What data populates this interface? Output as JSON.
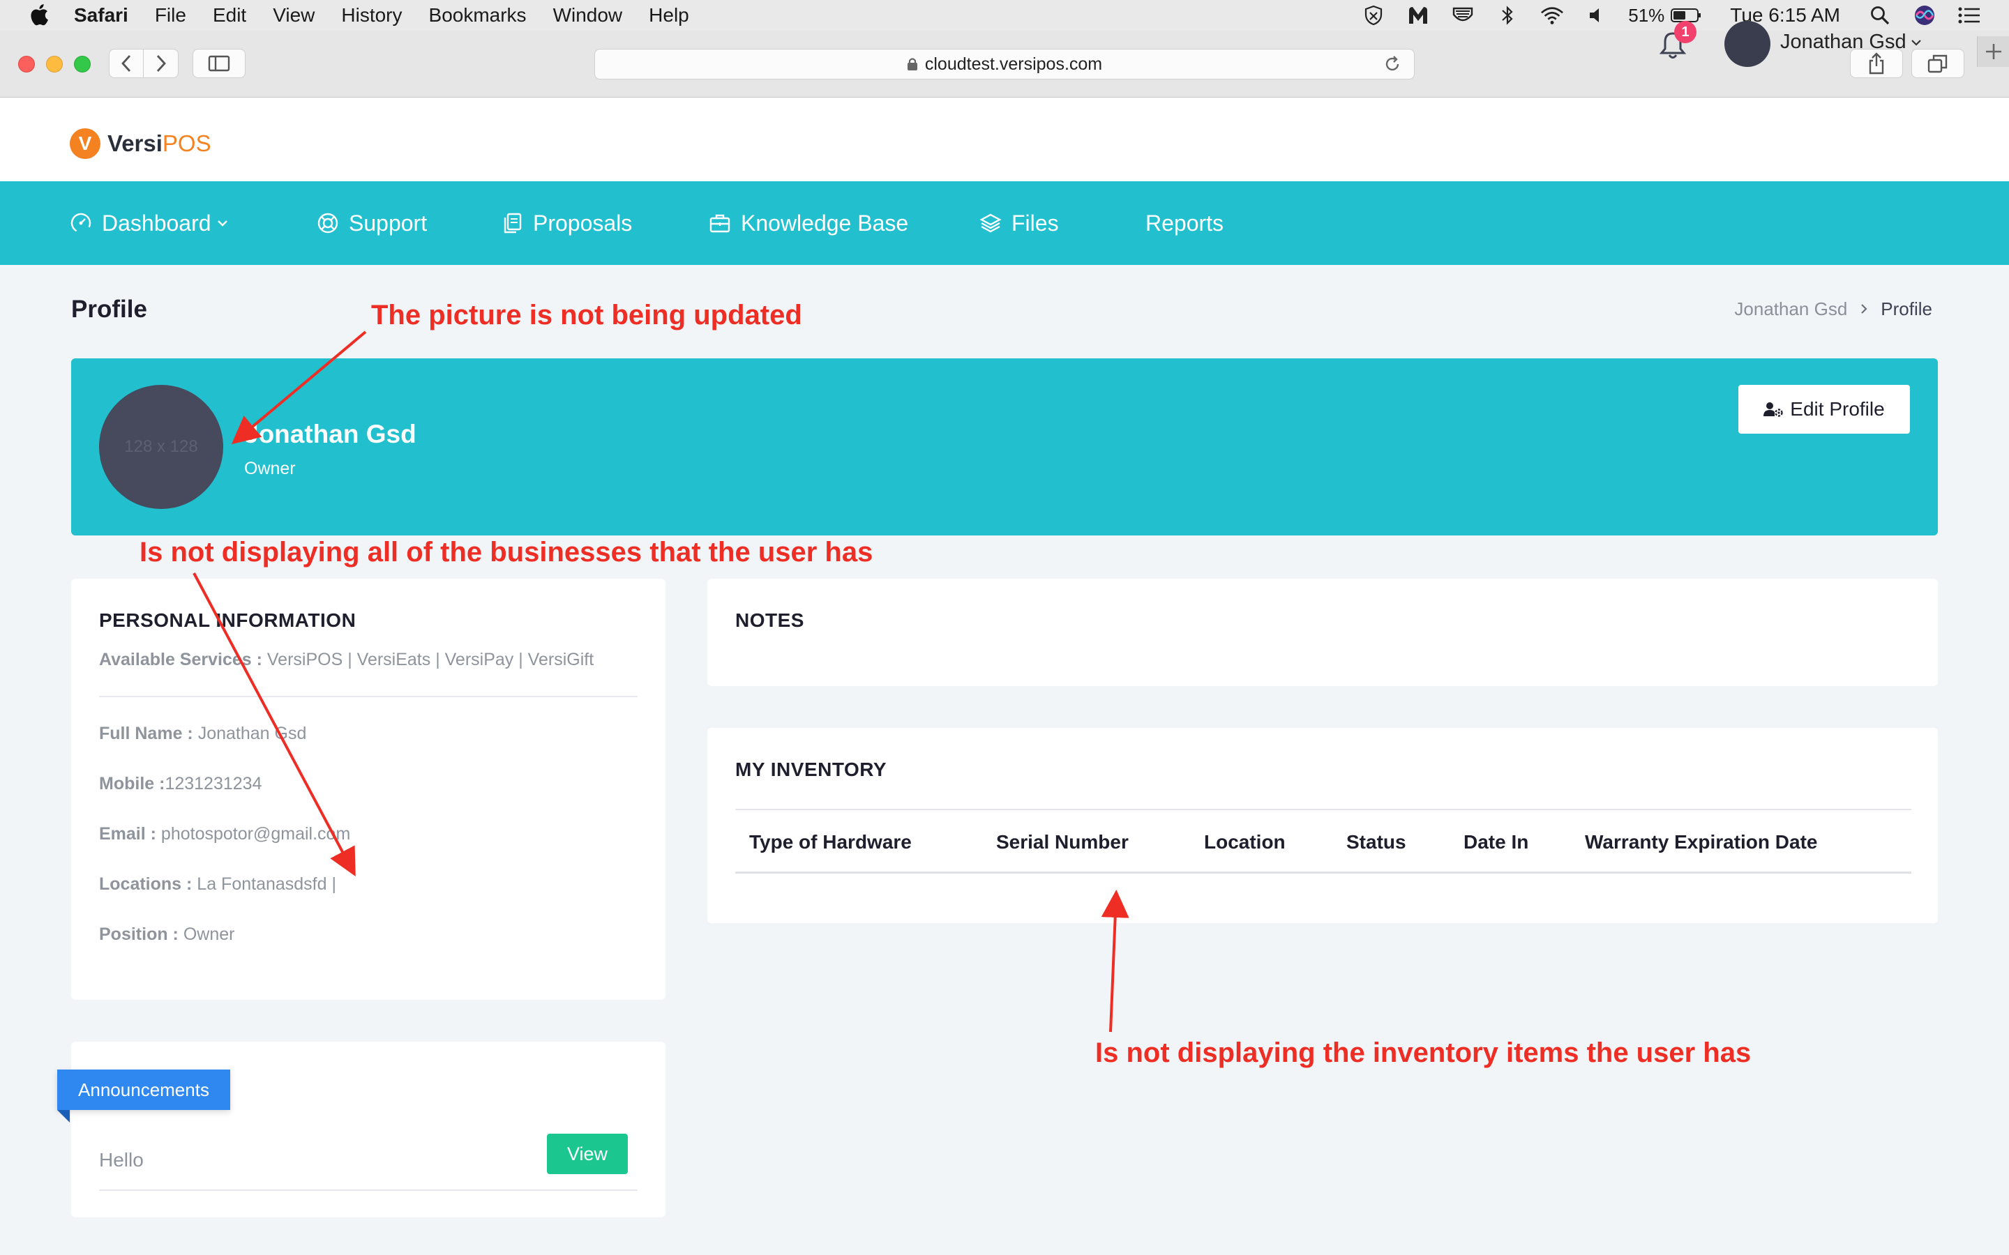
{
  "menubar": {
    "app": "Safari",
    "items": [
      "File",
      "Edit",
      "View",
      "History",
      "Bookmarks",
      "Window",
      "Help"
    ],
    "battery": "51%",
    "clock": "Tue 6:15 AM",
    "icons": [
      "shield-icon",
      "malwarebytes-icon",
      "drive-icon",
      "bluetooth-icon",
      "wifi-icon",
      "volume-icon",
      "battery-icon",
      "search-icon",
      "siri-icon",
      "list-icon"
    ]
  },
  "browser": {
    "url": "cloudtest.versipos.com"
  },
  "header": {
    "logo_mark": "V",
    "logo_versi": "Versi",
    "logo_pos": "POS",
    "notification_count": "1",
    "user_name": "Jonathan Gsd"
  },
  "nav": {
    "items": [
      {
        "label": "Dashboard",
        "icon": "gauge-icon"
      },
      {
        "label": "Support",
        "icon": "lifebuoy-icon"
      },
      {
        "label": "Proposals",
        "icon": "documents-icon"
      },
      {
        "label": "Knowledge Base",
        "icon": "briefcase-icon"
      },
      {
        "label": "Files",
        "icon": "layers-icon"
      },
      {
        "label": "Reports",
        "icon": ""
      }
    ]
  },
  "page": {
    "title": "Profile",
    "breadcrumb": [
      "Jonathan Gsd",
      "Profile"
    ]
  },
  "profile": {
    "avatar_placeholder": "128 x 128",
    "name": "Jonathan Gsd",
    "role": "Owner",
    "edit_label": "Edit Profile"
  },
  "personal": {
    "title": "PERSONAL INFORMATION",
    "services_label": "Available Services :",
    "services_value": " VersiPOS | VersiEats | VersiPay | VersiGift",
    "full_name_label": "Full Name :",
    "full_name_value": " Jonathan Gsd",
    "mobile_label": "Mobile :",
    "mobile_value": "1231231234",
    "email_label": "Email :",
    "email_value": " photospotor@gmail.com",
    "locations_label": "Locations :",
    "locations_value": " La Fontanasdsfd |",
    "position_label": "Position :",
    "position_value": " Owner"
  },
  "notes": {
    "title": "NOTES"
  },
  "inventory": {
    "title": "MY INVENTORY",
    "columns": [
      "Type of Hardware",
      "Serial Number",
      "Location",
      "Status",
      "Date In",
      "Warranty Expiration Date"
    ]
  },
  "announcements": {
    "ribbon": "Announcements",
    "item": "Hello",
    "view_label": "View"
  },
  "annotations": {
    "picture": "The picture is not being updated",
    "businesses": "Is not displaying all of the businesses that the user has",
    "inventory": "Is not displaying the inventory items the user has"
  },
  "colors": {
    "teal": "#22bfcf",
    "annotation_red": "#ee2e24",
    "brand_orange": "#f58220",
    "view_green": "#1bc78e",
    "ribbon_blue": "#2f88f0"
  }
}
